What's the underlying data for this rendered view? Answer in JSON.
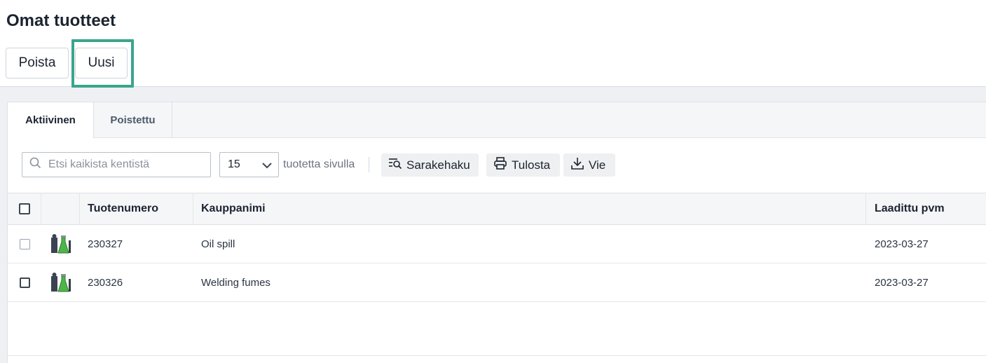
{
  "page": {
    "title": "Omat tuotteet",
    "actions": {
      "delete_label": "Poista",
      "new_label": "Uusi"
    }
  },
  "tabs": [
    {
      "label": "Aktiivinen",
      "active": true
    },
    {
      "label": "Poistettu",
      "active": false
    }
  ],
  "toolbar": {
    "search_placeholder": "Etsi kaikista kentistä",
    "search_value": "",
    "page_size_selected": "15",
    "page_size_label": "tuotetta sivulla",
    "column_search_label": "Sarakehaku",
    "print_label": "Tulosta",
    "export_label": "Vie"
  },
  "table": {
    "columns": {
      "number": "Tuotenumero",
      "name": "Kauppanimi",
      "created": "Laadittu pvm"
    },
    "rows": [
      {
        "number": "230327",
        "name": "Oil spill",
        "created": "2023-03-27"
      },
      {
        "number": "230326",
        "name": "Welding fumes",
        "created": "2023-03-27"
      }
    ]
  },
  "colors": {
    "highlight": "#3aa58c",
    "accent_green": "#4cb648"
  },
  "icons": {
    "search": "search-icon",
    "dropdown": "chevron-down-icon",
    "column_search": "column-search-icon",
    "print": "printer-icon",
    "export": "download-icon",
    "product": "product-icon"
  }
}
